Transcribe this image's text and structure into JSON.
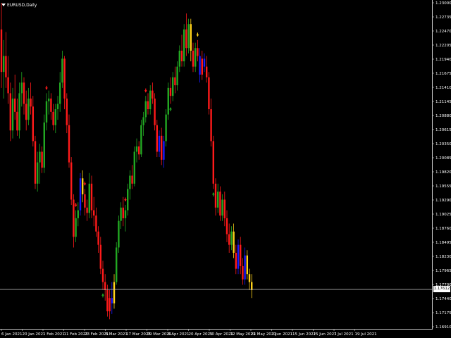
{
  "window": {
    "title": "EURUSD,Daily"
  },
  "current_price_label": "1.17612",
  "colors": {
    "background": "#000000",
    "up_candle": "#22a822",
    "down_candle": "#ff1a1a",
    "signal_blue": "#1a1aff",
    "signal_yellow": "#ffd21a",
    "axis_text": "#ffffff",
    "price_line": "#c8c8c8"
  },
  "chart_data": {
    "type": "candlestick",
    "title": "EURUSD,Daily",
    "y_ticks": [
      "1.23000",
      "1.22735",
      "1.22470",
      "1.22205",
      "1.21940",
      "1.21675",
      "1.21410",
      "1.21145",
      "1.20880",
      "1.20615",
      "1.20350",
      "1.20085",
      "1.19820",
      "1.19555",
      "1.19290",
      "1.19025",
      "1.18760",
      "1.18495",
      "1.18230",
      "1.17965",
      "1.17700",
      "1.17440",
      "1.17175",
      "1.16910"
    ],
    "x_ticks": [
      "6 Jan 2021",
      "20 Jan 2021",
      "1 Feb 2021",
      "11 Feb 2021",
      "23 Feb 2021",
      "5 Mar 2021",
      "17 Mar 2021",
      "29 Mar 2021",
      "8 Apr 2021",
      "20 Apr 2021",
      "30 Apr 2021",
      "12 May 2021",
      "24 May 2021",
      "3 Jun 2021",
      "15 Jun 2021",
      "25 Jun 2021",
      "7 Jul 2021",
      "19 Jul 2021"
    ],
    "ylim": [
      1.1691,
      1.23
    ],
    "current_price": 1.17612,
    "signal_arrows": [
      {
        "index": 20,
        "direction": "down",
        "color": "down"
      },
      {
        "index": 33,
        "direction": "down",
        "color": "down"
      },
      {
        "index": 37,
        "direction": "down",
        "color": "down"
      },
      {
        "index": 45,
        "direction": "up",
        "color": "up"
      },
      {
        "index": 55,
        "direction": "down",
        "color": "down"
      },
      {
        "index": 64,
        "direction": "down",
        "color": "down"
      },
      {
        "index": 75,
        "direction": "up",
        "color": "up"
      },
      {
        "index": 87,
        "direction": "down",
        "color": "yellow"
      },
      {
        "index": 94,
        "direction": "up",
        "color": "up"
      },
      {
        "index": 115,
        "direction": "down",
        "color": "yellow"
      },
      {
        "index": 120,
        "direction": "up",
        "color": "up"
      },
      {
        "index": 126,
        "direction": "up",
        "color": "up"
      },
      {
        "index": 151,
        "direction": "down",
        "color": "down"
      },
      {
        "index": 155,
        "direction": "down",
        "color": "down"
      },
      {
        "index": 162,
        "direction": "down",
        "color": "down"
      }
    ],
    "candles": [
      {
        "o": 1.225,
        "h": 1.23,
        "l": 1.214,
        "c": 1.217,
        "t": "down"
      },
      {
        "o": 1.217,
        "h": 1.223,
        "l": 1.212,
        "c": 1.22,
        "t": "up"
      },
      {
        "o": 1.22,
        "h": 1.2245,
        "l": 1.214,
        "c": 1.216,
        "t": "down"
      },
      {
        "o": 1.216,
        "h": 1.22,
        "l": 1.211,
        "c": 1.213,
        "t": "down"
      },
      {
        "o": 1.213,
        "h": 1.215,
        "l": 1.204,
        "c": 1.206,
        "t": "down"
      },
      {
        "o": 1.206,
        "h": 1.214,
        "l": 1.2045,
        "c": 1.212,
        "t": "up"
      },
      {
        "o": 1.212,
        "h": 1.2165,
        "l": 1.208,
        "c": 1.2095,
        "t": "down"
      },
      {
        "o": 1.2095,
        "h": 1.212,
        "l": 1.205,
        "c": 1.206,
        "t": "down"
      },
      {
        "o": 1.206,
        "h": 1.215,
        "l": 1.2045,
        "c": 1.213,
        "t": "up"
      },
      {
        "o": 1.213,
        "h": 1.217,
        "l": 1.2105,
        "c": 1.215,
        "t": "up"
      },
      {
        "o": 1.215,
        "h": 1.216,
        "l": 1.209,
        "c": 1.211,
        "t": "down"
      },
      {
        "o": 1.211,
        "h": 1.2135,
        "l": 1.206,
        "c": 1.208,
        "t": "down"
      },
      {
        "o": 1.208,
        "h": 1.214,
        "l": 1.207,
        "c": 1.212,
        "t": "up"
      },
      {
        "o": 1.212,
        "h": 1.215,
        "l": 1.209,
        "c": 1.2105,
        "t": "down"
      },
      {
        "o": 1.2105,
        "h": 1.2125,
        "l": 1.203,
        "c": 1.204,
        "t": "down"
      },
      {
        "o": 1.204,
        "h": 1.205,
        "l": 1.195,
        "c": 1.196,
        "t": "down"
      },
      {
        "o": 1.196,
        "h": 1.202,
        "l": 1.1945,
        "c": 1.2,
        "t": "up"
      },
      {
        "o": 1.2,
        "h": 1.2035,
        "l": 1.196,
        "c": 1.202,
        "t": "up"
      },
      {
        "o": 1.202,
        "h": 1.203,
        "l": 1.198,
        "c": 1.199,
        "t": "down"
      },
      {
        "o": 1.199,
        "h": 1.209,
        "l": 1.198,
        "c": 1.2075,
        "t": "up"
      },
      {
        "o": 1.2075,
        "h": 1.213,
        "l": 1.206,
        "c": 1.2115,
        "t": "up"
      },
      {
        "o": 1.2115,
        "h": 1.2135,
        "l": 1.209,
        "c": 1.212,
        "t": "up"
      },
      {
        "o": 1.212,
        "h": 1.213,
        "l": 1.208,
        "c": 1.2095,
        "t": "down"
      },
      {
        "o": 1.2095,
        "h": 1.211,
        "l": 1.206,
        "c": 1.207,
        "t": "down"
      },
      {
        "o": 1.207,
        "h": 1.211,
        "l": 1.2055,
        "c": 1.21,
        "t": "up"
      },
      {
        "o": 1.21,
        "h": 1.2125,
        "l": 1.208,
        "c": 1.211,
        "t": "up"
      },
      {
        "o": 1.211,
        "h": 1.217,
        "l": 1.2095,
        "c": 1.215,
        "t": "up"
      },
      {
        "o": 1.215,
        "h": 1.221,
        "l": 1.214,
        "c": 1.2195,
        "t": "up"
      },
      {
        "o": 1.2195,
        "h": 1.22,
        "l": 1.21,
        "c": 1.212,
        "t": "down"
      },
      {
        "o": 1.212,
        "h": 1.213,
        "l": 1.2055,
        "c": 1.207,
        "t": "down"
      },
      {
        "o": 1.207,
        "h": 1.209,
        "l": 1.199,
        "c": 1.2,
        "t": "down"
      },
      {
        "o": 1.2,
        "h": 1.201,
        "l": 1.192,
        "c": 1.193,
        "t": "down"
      },
      {
        "o": 1.193,
        "h": 1.194,
        "l": 1.184,
        "c": 1.186,
        "t": "down"
      },
      {
        "o": 1.186,
        "h": 1.191,
        "l": 1.185,
        "c": 1.1895,
        "t": "up"
      },
      {
        "o": 1.1895,
        "h": 1.1925,
        "l": 1.188,
        "c": 1.191,
        "t": "up"
      },
      {
        "o": 1.191,
        "h": 1.198,
        "l": 1.19,
        "c": 1.197,
        "t": "blue"
      },
      {
        "o": 1.197,
        "h": 1.1985,
        "l": 1.1925,
        "c": 1.194,
        "t": "yellow"
      },
      {
        "o": 1.194,
        "h": 1.195,
        "l": 1.19,
        "c": 1.1915,
        "t": "down"
      },
      {
        "o": 1.1915,
        "h": 1.193,
        "l": 1.189,
        "c": 1.1905,
        "t": "down"
      },
      {
        "o": 1.1905,
        "h": 1.198,
        "l": 1.1895,
        "c": 1.196,
        "t": "up"
      },
      {
        "o": 1.196,
        "h": 1.1975,
        "l": 1.1895,
        "c": 1.191,
        "t": "down"
      },
      {
        "o": 1.191,
        "h": 1.1935,
        "l": 1.188,
        "c": 1.19,
        "t": "down"
      },
      {
        "o": 1.19,
        "h": 1.1915,
        "l": 1.186,
        "c": 1.187,
        "t": "down"
      },
      {
        "o": 1.187,
        "h": 1.188,
        "l": 1.183,
        "c": 1.1845,
        "t": "down"
      },
      {
        "o": 1.1845,
        "h": 1.186,
        "l": 1.179,
        "c": 1.18,
        "t": "down"
      },
      {
        "o": 1.18,
        "h": 1.1815,
        "l": 1.176,
        "c": 1.1775,
        "t": "down"
      },
      {
        "o": 1.1775,
        "h": 1.179,
        "l": 1.174,
        "c": 1.176,
        "t": "down"
      },
      {
        "o": 1.176,
        "h": 1.177,
        "l": 1.171,
        "c": 1.172,
        "t": "down"
      },
      {
        "o": 1.172,
        "h": 1.176,
        "l": 1.1705,
        "c": 1.1745,
        "t": "down"
      },
      {
        "o": 1.1745,
        "h": 1.1775,
        "l": 1.1715,
        "c": 1.1735,
        "t": "blue"
      },
      {
        "o": 1.1735,
        "h": 1.179,
        "l": 1.1725,
        "c": 1.1775,
        "t": "yellow"
      },
      {
        "o": 1.1775,
        "h": 1.185,
        "l": 1.177,
        "c": 1.184,
        "t": "up"
      },
      {
        "o": 1.184,
        "h": 1.19,
        "l": 1.183,
        "c": 1.189,
        "t": "up"
      },
      {
        "o": 1.189,
        "h": 1.1925,
        "l": 1.1875,
        "c": 1.1915,
        "t": "up"
      },
      {
        "o": 1.1915,
        "h": 1.1935,
        "l": 1.188,
        "c": 1.1895,
        "t": "down"
      },
      {
        "o": 1.1895,
        "h": 1.192,
        "l": 1.187,
        "c": 1.191,
        "t": "up"
      },
      {
        "o": 1.191,
        "h": 1.196,
        "l": 1.19,
        "c": 1.195,
        "t": "up"
      },
      {
        "o": 1.195,
        "h": 1.1985,
        "l": 1.193,
        "c": 1.1975,
        "t": "up"
      },
      {
        "o": 1.1975,
        "h": 1.1995,
        "l": 1.195,
        "c": 1.196,
        "t": "down"
      },
      {
        "o": 1.196,
        "h": 1.203,
        "l": 1.1955,
        "c": 1.202,
        "t": "up"
      },
      {
        "o": 1.202,
        "h": 1.2045,
        "l": 1.2,
        "c": 1.203,
        "t": "up"
      },
      {
        "o": 1.203,
        "h": 1.204,
        "l": 1.2005,
        "c": 1.2015,
        "t": "down"
      },
      {
        "o": 1.2015,
        "h": 1.208,
        "l": 1.201,
        "c": 1.207,
        "t": "up"
      },
      {
        "o": 1.207,
        "h": 1.2095,
        "l": 1.205,
        "c": 1.2085,
        "t": "up"
      },
      {
        "o": 1.2085,
        "h": 1.2125,
        "l": 1.2075,
        "c": 1.2115,
        "t": "up"
      },
      {
        "o": 1.2115,
        "h": 1.213,
        "l": 1.209,
        "c": 1.21,
        "t": "down"
      },
      {
        "o": 1.21,
        "h": 1.2145,
        "l": 1.209,
        "c": 1.2135,
        "t": "up"
      },
      {
        "o": 1.2135,
        "h": 1.215,
        "l": 1.211,
        "c": 1.212,
        "t": "down"
      },
      {
        "o": 1.212,
        "h": 1.213,
        "l": 1.206,
        "c": 1.207,
        "t": "down"
      },
      {
        "o": 1.207,
        "h": 1.208,
        "l": 1.201,
        "c": 1.202,
        "t": "down"
      },
      {
        "o": 1.202,
        "h": 1.206,
        "l": 1.201,
        "c": 1.205,
        "t": "blue"
      },
      {
        "o": 1.205,
        "h": 1.2065,
        "l": 1.1995,
        "c": 1.2005,
        "t": "down"
      },
      {
        "o": 1.2005,
        "h": 1.205,
        "l": 1.199,
        "c": 1.204,
        "t": "blue"
      },
      {
        "o": 1.204,
        "h": 1.21,
        "l": 1.203,
        "c": 1.209,
        "t": "up"
      },
      {
        "o": 1.209,
        "h": 1.215,
        "l": 1.208,
        "c": 1.214,
        "t": "up"
      },
      {
        "o": 1.214,
        "h": 1.216,
        "l": 1.211,
        "c": 1.2125,
        "t": "down"
      },
      {
        "o": 1.2125,
        "h": 1.217,
        "l": 1.2115,
        "c": 1.216,
        "t": "up"
      },
      {
        "o": 1.216,
        "h": 1.218,
        "l": 1.213,
        "c": 1.2145,
        "t": "down"
      },
      {
        "o": 1.2145,
        "h": 1.219,
        "l": 1.2135,
        "c": 1.218,
        "t": "up"
      },
      {
        "o": 1.218,
        "h": 1.222,
        "l": 1.217,
        "c": 1.221,
        "t": "up"
      },
      {
        "o": 1.221,
        "h": 1.224,
        "l": 1.218,
        "c": 1.219,
        "t": "down"
      },
      {
        "o": 1.219,
        "h": 1.226,
        "l": 1.218,
        "c": 1.225,
        "t": "up"
      },
      {
        "o": 1.225,
        "h": 1.228,
        "l": 1.22,
        "c": 1.2215,
        "t": "down"
      },
      {
        "o": 1.2215,
        "h": 1.227,
        "l": 1.2205,
        "c": 1.226,
        "t": "up"
      },
      {
        "o": 1.226,
        "h": 1.227,
        "l": 1.219,
        "c": 1.221,
        "t": "yellow"
      },
      {
        "o": 1.221,
        "h": 1.2225,
        "l": 1.217,
        "c": 1.218,
        "t": "down"
      },
      {
        "o": 1.218,
        "h": 1.2225,
        "l": 1.217,
        "c": 1.2215,
        "t": "up"
      },
      {
        "o": 1.2215,
        "h": 1.223,
        "l": 1.219,
        "c": 1.22,
        "t": "down"
      },
      {
        "o": 1.22,
        "h": 1.2215,
        "l": 1.215,
        "c": 1.2165,
        "t": "blue"
      },
      {
        "o": 1.2165,
        "h": 1.221,
        "l": 1.2155,
        "c": 1.2195,
        "t": "down"
      },
      {
        "o": 1.2195,
        "h": 1.2205,
        "l": 1.217,
        "c": 1.218,
        "t": "blue"
      },
      {
        "o": 1.218,
        "h": 1.22,
        "l": 1.215,
        "c": 1.216,
        "t": "down"
      },
      {
        "o": 1.216,
        "h": 1.217,
        "l": 1.209,
        "c": 1.21,
        "t": "down"
      },
      {
        "o": 1.21,
        "h": 1.212,
        "l": 1.203,
        "c": 1.204,
        "t": "down"
      },
      {
        "o": 1.204,
        "h": 1.205,
        "l": 1.195,
        "c": 1.196,
        "t": "down"
      },
      {
        "o": 1.196,
        "h": 1.197,
        "l": 1.19,
        "c": 1.1915,
        "t": "down"
      },
      {
        "o": 1.1915,
        "h": 1.196,
        "l": 1.1905,
        "c": 1.1945,
        "t": "up"
      },
      {
        "o": 1.1945,
        "h": 1.1955,
        "l": 1.189,
        "c": 1.19,
        "t": "down"
      },
      {
        "o": 1.19,
        "h": 1.194,
        "l": 1.189,
        "c": 1.193,
        "t": "up"
      },
      {
        "o": 1.193,
        "h": 1.1945,
        "l": 1.188,
        "c": 1.1895,
        "t": "down"
      },
      {
        "o": 1.1895,
        "h": 1.191,
        "l": 1.185,
        "c": 1.1865,
        "t": "down"
      },
      {
        "o": 1.1865,
        "h": 1.1885,
        "l": 1.183,
        "c": 1.1845,
        "t": "down"
      },
      {
        "o": 1.1845,
        "h": 1.188,
        "l": 1.1835,
        "c": 1.187,
        "t": "up"
      },
      {
        "o": 1.187,
        "h": 1.1885,
        "l": 1.182,
        "c": 1.183,
        "t": "yellow"
      },
      {
        "o": 1.183,
        "h": 1.1845,
        "l": 1.179,
        "c": 1.18,
        "t": "down"
      },
      {
        "o": 1.18,
        "h": 1.1855,
        "l": 1.179,
        "c": 1.1845,
        "t": "blue"
      },
      {
        "o": 1.1845,
        "h": 1.186,
        "l": 1.179,
        "c": 1.1805,
        "t": "down"
      },
      {
        "o": 1.1805,
        "h": 1.182,
        "l": 1.177,
        "c": 1.178,
        "t": "down"
      },
      {
        "o": 1.178,
        "h": 1.184,
        "l": 1.177,
        "c": 1.1825,
        "t": "blue"
      },
      {
        "o": 1.1825,
        "h": 1.1835,
        "l": 1.178,
        "c": 1.179,
        "t": "yellow"
      },
      {
        "o": 1.179,
        "h": 1.18,
        "l": 1.176,
        "c": 1.1775,
        "t": "yellow"
      },
      {
        "o": 1.1775,
        "h": 1.179,
        "l": 1.1745,
        "c": 1.176,
        "t": "yellow"
      }
    ]
  }
}
